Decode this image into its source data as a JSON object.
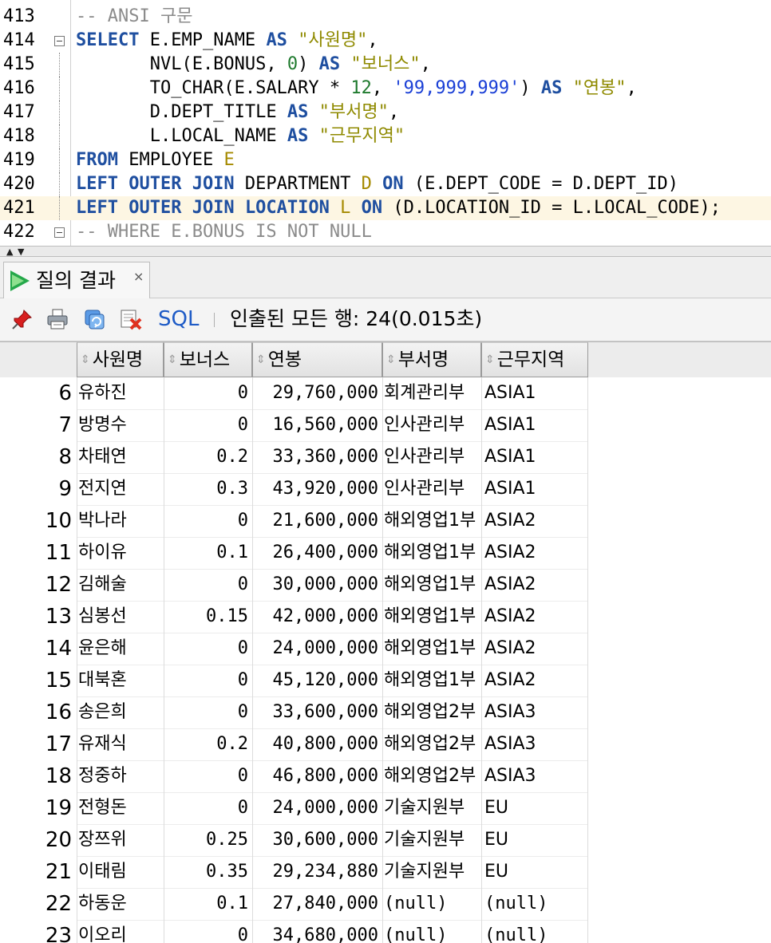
{
  "editor": {
    "lines": [
      {
        "num": "413",
        "tokens": [
          {
            "t": "-- ANSI 구문",
            "c": "cmt"
          }
        ]
      },
      {
        "num": "414",
        "fold": true,
        "tokens": [
          {
            "t": "SELECT",
            "c": "kw"
          },
          {
            "t": " E.EMP_NAME ",
            "c": "plain"
          },
          {
            "t": "AS",
            "c": "kw"
          },
          {
            "t": " ",
            "c": "plain"
          },
          {
            "t": "\"사원명\"",
            "c": "str"
          },
          {
            "t": ",",
            "c": "plain"
          }
        ]
      },
      {
        "num": "415",
        "tokens": [
          {
            "t": "       NVL(E.BONUS, ",
            "c": "plain"
          },
          {
            "t": "0",
            "c": "num"
          },
          {
            "t": ") ",
            "c": "plain"
          },
          {
            "t": "AS",
            "c": "kw"
          },
          {
            "t": " ",
            "c": "plain"
          },
          {
            "t": "\"보너스\"",
            "c": "str"
          },
          {
            "t": ",",
            "c": "plain"
          }
        ]
      },
      {
        "num": "416",
        "tokens": [
          {
            "t": "       TO_CHAR(E.SALARY * ",
            "c": "plain"
          },
          {
            "t": "12",
            "c": "num"
          },
          {
            "t": ", ",
            "c": "plain"
          },
          {
            "t": "'99,999,999'",
            "c": "num-str"
          },
          {
            "t": ") ",
            "c": "plain"
          },
          {
            "t": "AS",
            "c": "kw"
          },
          {
            "t": " ",
            "c": "plain"
          },
          {
            "t": "\"연봉\"",
            "c": "str"
          },
          {
            "t": ",",
            "c": "plain"
          }
        ]
      },
      {
        "num": "417",
        "tokens": [
          {
            "t": "       D.DEPT_TITLE ",
            "c": "plain"
          },
          {
            "t": "AS",
            "c": "kw"
          },
          {
            "t": " ",
            "c": "plain"
          },
          {
            "t": "\"부서명\"",
            "c": "str"
          },
          {
            "t": ",",
            "c": "plain"
          }
        ]
      },
      {
        "num": "418",
        "tokens": [
          {
            "t": "       L.LOCAL_NAME ",
            "c": "plain"
          },
          {
            "t": "AS",
            "c": "kw"
          },
          {
            "t": " ",
            "c": "plain"
          },
          {
            "t": "\"근무지역\"",
            "c": "str"
          }
        ]
      },
      {
        "num": "419",
        "tokens": [
          {
            "t": "FROM",
            "c": "kw"
          },
          {
            "t": " EMPLOYEE ",
            "c": "plain"
          },
          {
            "t": "E",
            "c": "alias"
          }
        ]
      },
      {
        "num": "420",
        "tokens": [
          {
            "t": "LEFT OUTER JOIN",
            "c": "kw"
          },
          {
            "t": " DEPARTMENT ",
            "c": "plain"
          },
          {
            "t": "D",
            "c": "alias"
          },
          {
            "t": " ",
            "c": "plain"
          },
          {
            "t": "ON",
            "c": "kw"
          },
          {
            "t": " (E.DEPT_CODE = D.DEPT_ID)",
            "c": "plain"
          }
        ]
      },
      {
        "num": "421",
        "current": true,
        "tokens": [
          {
            "t": "LEFT OUTER JOIN",
            "c": "kw"
          },
          {
            "t": " ",
            "c": "plain"
          },
          {
            "t": "LOCATION",
            "c": "kw"
          },
          {
            "t": " ",
            "c": "plain"
          },
          {
            "t": "L",
            "c": "alias"
          },
          {
            "t": " ",
            "c": "plain"
          },
          {
            "t": "ON",
            "c": "kw"
          },
          {
            "t": " (D.LOCATION_ID = L.LOCAL_CODE);",
            "c": "plain"
          }
        ]
      },
      {
        "num": "422",
        "fold": true,
        "tokens": [
          {
            "t": "-- WHERE E.BONUS IS NOT NULL",
            "c": "cmt"
          }
        ]
      }
    ]
  },
  "results": {
    "tab_label": "질의 결과",
    "tab_close": "×",
    "sql_label": "SQL",
    "fetch_status": "인출된 모든 행: 24(0.015초)",
    "columns": [
      "사원명",
      "보너스",
      "연봉",
      "부서명",
      "근무지역"
    ],
    "rows": [
      {
        "n": "6",
        "name": "유하진",
        "bonus": "0",
        "salary": "29,760,000",
        "dept": "회계관리부",
        "loc": "ASIA1"
      },
      {
        "n": "7",
        "name": "방명수",
        "bonus": "0",
        "salary": "16,560,000",
        "dept": "인사관리부",
        "loc": "ASIA1"
      },
      {
        "n": "8",
        "name": "차태연",
        "bonus": "0.2",
        "salary": "33,360,000",
        "dept": "인사관리부",
        "loc": "ASIA1"
      },
      {
        "n": "9",
        "name": "전지연",
        "bonus": "0.3",
        "salary": "43,920,000",
        "dept": "인사관리부",
        "loc": "ASIA1"
      },
      {
        "n": "10",
        "name": "박나라",
        "bonus": "0",
        "salary": "21,600,000",
        "dept": "해외영업1부",
        "loc": "ASIA2"
      },
      {
        "n": "11",
        "name": "하이유",
        "bonus": "0.1",
        "salary": "26,400,000",
        "dept": "해외영업1부",
        "loc": "ASIA2"
      },
      {
        "n": "12",
        "name": "김해술",
        "bonus": "0",
        "salary": "30,000,000",
        "dept": "해외영업1부",
        "loc": "ASIA2"
      },
      {
        "n": "13",
        "name": "심봉선",
        "bonus": "0.15",
        "salary": "42,000,000",
        "dept": "해외영업1부",
        "loc": "ASIA2"
      },
      {
        "n": "14",
        "name": "윤은해",
        "bonus": "0",
        "salary": "24,000,000",
        "dept": "해외영업1부",
        "loc": "ASIA2"
      },
      {
        "n": "15",
        "name": "대북혼",
        "bonus": "0",
        "salary": "45,120,000",
        "dept": "해외영업1부",
        "loc": "ASIA2"
      },
      {
        "n": "16",
        "name": "송은희",
        "bonus": "0",
        "salary": "33,600,000",
        "dept": "해외영업2부",
        "loc": "ASIA3"
      },
      {
        "n": "17",
        "name": "유재식",
        "bonus": "0.2",
        "salary": "40,800,000",
        "dept": "해외영업2부",
        "loc": "ASIA3"
      },
      {
        "n": "18",
        "name": "정중하",
        "bonus": "0",
        "salary": "46,800,000",
        "dept": "해외영업2부",
        "loc": "ASIA3"
      },
      {
        "n": "19",
        "name": "전형돈",
        "bonus": "0",
        "salary": "24,000,000",
        "dept": "기술지원부",
        "loc": "EU"
      },
      {
        "n": "20",
        "name": "장쯔위",
        "bonus": "0.25",
        "salary": "30,600,000",
        "dept": "기술지원부",
        "loc": "EU"
      },
      {
        "n": "21",
        "name": "이태림",
        "bonus": "0.35",
        "salary": "29,234,880",
        "dept": "기술지원부",
        "loc": "EU"
      },
      {
        "n": "22",
        "name": "하동운",
        "bonus": "0.1",
        "salary": "27,840,000",
        "dept": "(null)",
        "loc": "(null)"
      },
      {
        "n": "23",
        "name": "이오리",
        "bonus": "0",
        "salary": "34,680,000",
        "dept": "(null)",
        "loc": "(null)"
      }
    ]
  },
  "icons": {
    "toolbar": [
      "pin-icon",
      "print-icon",
      "refresh-icon",
      "delete-icon"
    ],
    "tab": "run-icon"
  },
  "colors": {
    "keyword": "#1f4fa0",
    "string": "#8f8a00",
    "number": "#1f7a2e",
    "comment": "#8b8b8b",
    "link": "#1e5bc6",
    "current_line": "#fdf6e3"
  }
}
